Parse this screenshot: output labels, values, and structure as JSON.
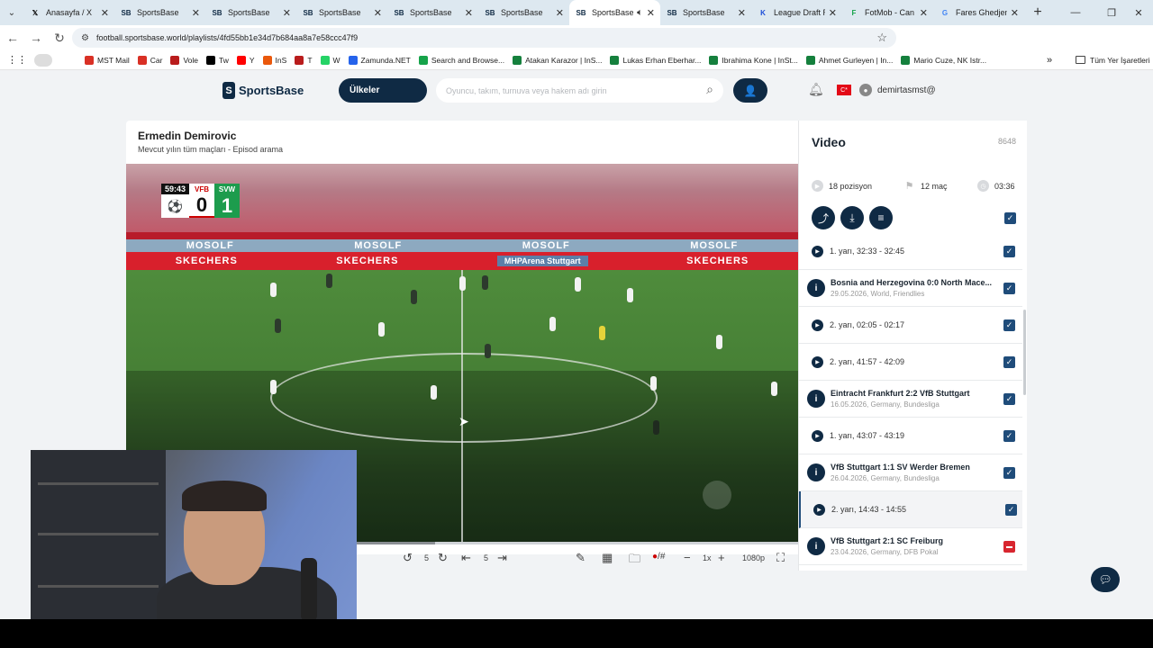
{
  "browser": {
    "tabs": [
      {
        "title": "Anasayfa / X",
        "fav": "𝕏",
        "fav_color": "#000000"
      },
      {
        "title": "SportsBase",
        "fav": "SB",
        "fav_color": "#0f2a44"
      },
      {
        "title": "SportsBase",
        "fav": "SB",
        "fav_color": "#0f2a44"
      },
      {
        "title": "SportsBase",
        "fav": "SB",
        "fav_color": "#0f2a44"
      },
      {
        "title": "SportsBase",
        "fav": "SB",
        "fav_color": "#0f2a44"
      },
      {
        "title": "SportsBase",
        "fav": "SB",
        "fav_color": "#0f2a44"
      },
      {
        "title": "SportsBase",
        "fav": "SB",
        "fav_color": "#0f2a44",
        "active": true
      },
      {
        "title": "SportsBase",
        "fav": "SB",
        "fav_color": "#0f2a44"
      },
      {
        "title": "League Draft R",
        "fav": "K",
        "fav_color": "#1d4ed8"
      },
      {
        "title": "FotMob - Can",
        "fav": "F",
        "fav_color": "#16a34a"
      },
      {
        "title": "Fares Ghedjem",
        "fav": "G",
        "fav_color": "#4285f4"
      }
    ],
    "url": "football.sportsbase.world/playlists/4fd55bb1e34d7b684aa8a7e58ccc47f9",
    "bookmarks": [
      {
        "label": "MST Mail",
        "color": "#d93025"
      },
      {
        "label": "Car",
        "color": "#d93025"
      },
      {
        "label": "Vole",
        "color": "#b91c1c"
      },
      {
        "label": "Tw",
        "color": "#000000"
      },
      {
        "label": "Y",
        "color": "#ff0000"
      },
      {
        "label": "InS",
        "color": "#ea580c"
      },
      {
        "label": "T",
        "color": "#b91c1c"
      },
      {
        "label": "W",
        "color": "#25d366"
      },
      {
        "label": "Zamunda.NET",
        "color": "#2563eb"
      },
      {
        "label": "Search and Browse...",
        "color": "#16a34a"
      },
      {
        "label": "Atakan Karazor | InS...",
        "color": "#15803d"
      },
      {
        "label": "Lukas Erhan Eberhar...",
        "color": "#15803d"
      },
      {
        "label": "Ibrahima Kone | InSt...",
        "color": "#15803d"
      },
      {
        "label": "Ahmet Gurleyen | In...",
        "color": "#15803d"
      },
      {
        "label": "Mario Cuze, NK Istr...",
        "color": "#15803d"
      }
    ],
    "all_bookmarks": "Tüm Yer İşaretleri"
  },
  "header": {
    "logo": "SportsBase",
    "countries_label": "Ülkeler",
    "search_placeholder": "Oyuncu, takım, turnuva veya hakem adı girin",
    "flag_label": "C*",
    "username": "demirtasmst@"
  },
  "main": {
    "player_name": "Ermedin Demirovic",
    "subtitle": "Mevcut yılın tüm maçları - Episod arama",
    "scoreboard": {
      "clock": "59:43",
      "home": "VFB",
      "home_score": "0",
      "away": "SVW",
      "away_score": "1"
    },
    "ads": {
      "row1": [
        "MOSOLF",
        "MOSOLF",
        "MOSOLF",
        "MOSOLF"
      ],
      "row2": [
        "SKECHERS",
        "SKECHERS",
        "SKECHERS"
      ],
      "arena": "MHPArena Stuttgart"
    },
    "progress": 0.46,
    "controls": {
      "rewind_seconds": "5",
      "step_value": "5",
      "speed": "1x",
      "quality": "1080p",
      "marker_label": "#"
    }
  },
  "panel": {
    "title": "Video",
    "count": "8648",
    "positions": "18 pozisyon",
    "matches": "12 maç",
    "duration": "03:36",
    "items": [
      {
        "type": "clip",
        "label": "1. yarı, 32:33 - 32:45",
        "checked": true
      },
      {
        "type": "match",
        "title": "Bosnia and Herzegovina 0:0 North Mace...",
        "meta": "29.05.2026, World, Friendlies",
        "checked": true
      },
      {
        "type": "clip",
        "label": "2. yarı, 02:05 - 02:17",
        "checked": true
      },
      {
        "type": "clip",
        "label": "2. yarı, 41:57 - 42:09",
        "checked": true
      },
      {
        "type": "match",
        "title": "Eintracht Frankfurt 2:2 VfB Stuttgart",
        "meta": "16.05.2026, Germany, Bundesliga",
        "checked": true
      },
      {
        "type": "clip",
        "label": "1. yarı, 43:07 - 43:19",
        "checked": true
      },
      {
        "type": "match",
        "title": "VfB Stuttgart 1:1 SV Werder Bremen",
        "meta": "26.04.2026, Germany, Bundesliga",
        "checked": true
      },
      {
        "type": "clip",
        "label": "2. yarı, 14:43 - 14:55",
        "checked": true,
        "selected": true
      },
      {
        "type": "match",
        "title": "VfB Stuttgart 2:1 SC Freiburg",
        "meta": "23.04.2026, Germany, DFB Pokal",
        "checked": "partial"
      }
    ]
  },
  "colors": {
    "brand_navy": "#0f2a44",
    "check_blue": "#1f4c7a",
    "partial_red": "#d8262f"
  }
}
